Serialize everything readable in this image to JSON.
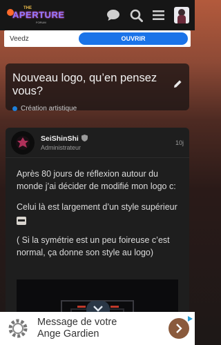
{
  "header": {
    "logo_top": "THE",
    "logo_word": "APERTURE",
    "logo_sub": "FORUM",
    "icons": [
      "chat-icon",
      "search-icon",
      "menu-icon",
      "user-avatar"
    ]
  },
  "ad_top": {
    "brand": "Veedz",
    "button_label": "OUVRIR"
  },
  "topic": {
    "title": "Nouveau logo, qu’en pensez vous?",
    "category": "Création artistique",
    "category_color": "#1e7fd8"
  },
  "post": {
    "author": "SeiShinShi",
    "role": "Administrateur",
    "age": "10j",
    "paragraphs": [
      "Après 80 jours de réflexion autour du monde j’ai décider de modifié mon logo c:",
      "Celui là est largement d’un style supérieur",
      "( Si la symétrie est un peu foireuse c’est normal, ça donne son style au logo)"
    ]
  },
  "ad_bottom": {
    "line1": "Message de votre",
    "line2": "Ange Gardien"
  },
  "colors": {
    "accent_blue": "#1a73e8",
    "header_bg": "#161616"
  }
}
